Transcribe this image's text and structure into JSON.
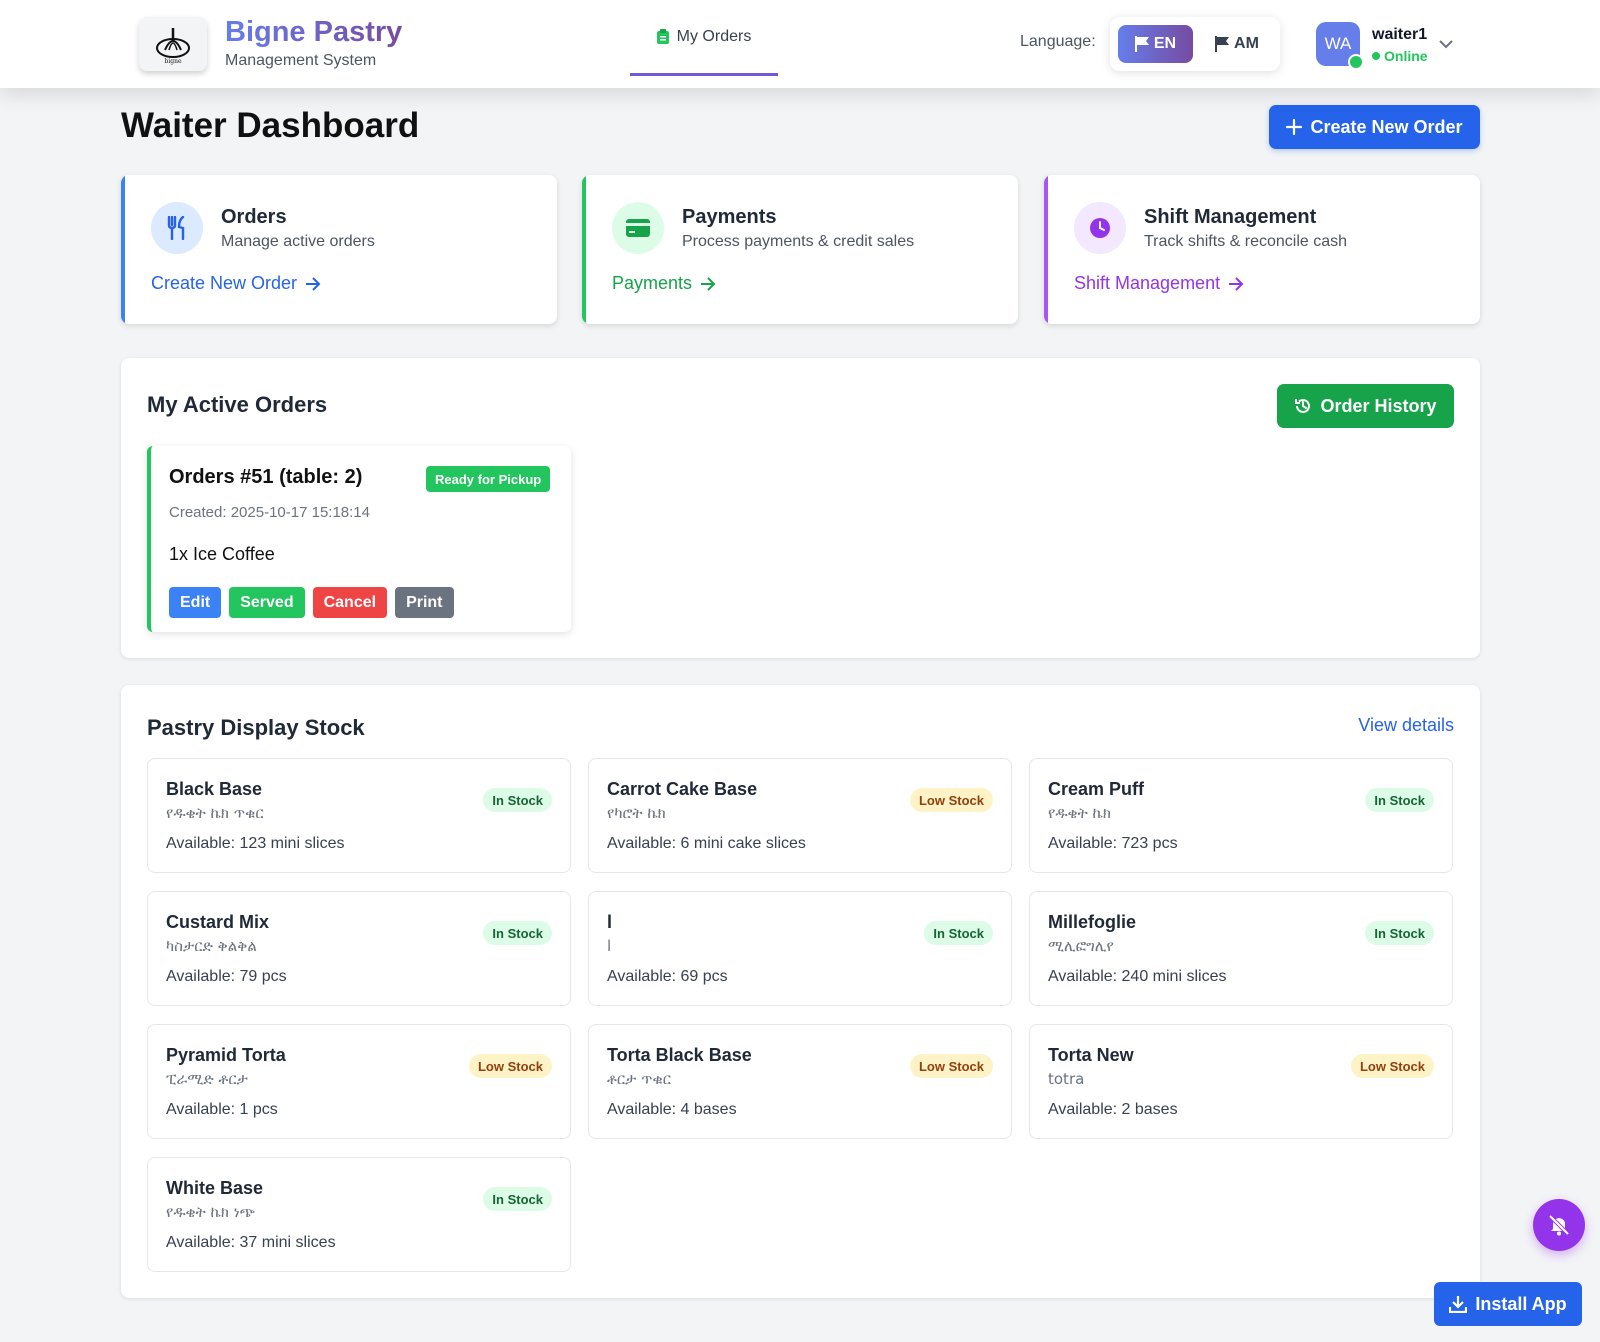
{
  "header": {
    "brand_name": "Bigne Pastry",
    "brand_sub": "Management System",
    "nav_tab": "My Orders",
    "language_label": "Language:",
    "lang_en": "EN",
    "lang_am": "AM",
    "avatar_initials": "WA",
    "user_name": "waiter1",
    "user_status": "Online"
  },
  "page": {
    "title": "Waiter Dashboard",
    "create_button": "Create New Order"
  },
  "quick_cards": [
    {
      "title": "Orders",
      "subtitle": "Manage active orders",
      "link": "Create New Order",
      "color": "#3b82f6"
    },
    {
      "title": "Payments",
      "subtitle": "Process payments & credit sales",
      "link": "Payments",
      "color": "#22c55e"
    },
    {
      "title": "Shift Management",
      "subtitle": "Track shifts & reconcile cash",
      "link": "Shift Management",
      "color": "#a855f7"
    }
  ],
  "active_orders": {
    "title": "My Active Orders",
    "history_button": "Order History",
    "orders": [
      {
        "title": "Orders #51 (table: 2)",
        "status": "Ready for Pickup",
        "created": "Created: 2025-10-17 15:18:14",
        "item": "1x Ice Coffee",
        "actions": [
          "Edit",
          "Served",
          "Cancel",
          "Print"
        ]
      }
    ]
  },
  "stock": {
    "title": "Pastry Display Stock",
    "view_details": "View details",
    "items": [
      {
        "name": "Black Base",
        "sub": "የዱቄት ኬክ ጥቁር",
        "available": "Available: 123 mini slices",
        "status": "In Stock"
      },
      {
        "name": "Carrot Cake Base",
        "sub": "የካሮት ኬክ",
        "available": "Available: 6 mini cake slices",
        "status": "Low Stock"
      },
      {
        "name": "Cream Puff",
        "sub": "የዱቄት ኬክ",
        "available": "Available: 723 pcs",
        "status": "In Stock"
      },
      {
        "name": "Custard Mix",
        "sub": "ካስታርድ ቅልቅል",
        "available": "Available: 79 pcs",
        "status": "In Stock"
      },
      {
        "name": "l",
        "sub": "l",
        "available": "Available: 69 pcs",
        "status": "In Stock"
      },
      {
        "name": "Millefoglie",
        "sub": "ሚሊፎግሊየ",
        "available": "Available: 240 mini slices",
        "status": "In Stock"
      },
      {
        "name": "Pyramid Torta",
        "sub": "ፒራሚድ ቶርታ",
        "available": "Available: 1 pcs",
        "status": "Low Stock"
      },
      {
        "name": "Torta Black Base",
        "sub": "ቶርታ ጥቁር",
        "available": "Available: 4 bases",
        "status": "Low Stock"
      },
      {
        "name": "Torta New",
        "sub": "totra",
        "available": "Available: 2 bases",
        "status": "Low Stock"
      },
      {
        "name": "White Base",
        "sub": "የዱቄት ኬክ ነጭ",
        "available": "Available: 37 mini slices",
        "status": "In Stock"
      }
    ]
  },
  "floating": {
    "install_button": "Install App"
  }
}
